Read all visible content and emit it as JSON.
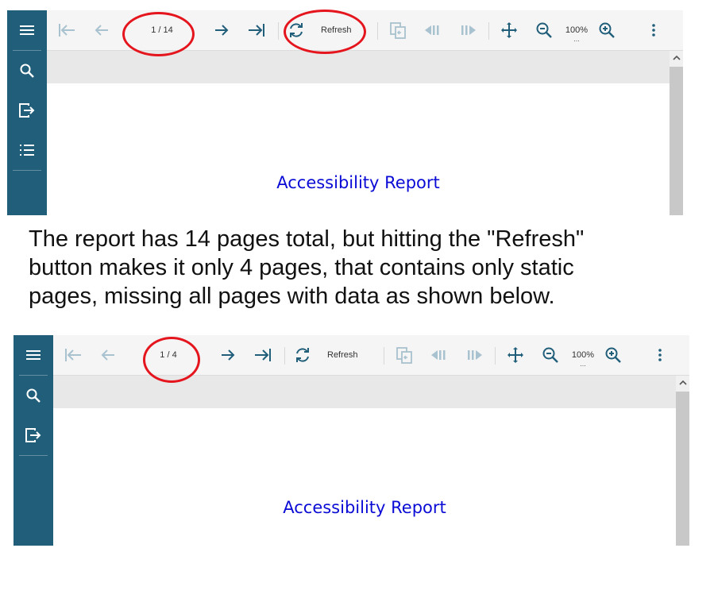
{
  "viewer_before": {
    "page_indicator": "1 / 14",
    "refresh_label": "Refresh",
    "zoom_level": "100%",
    "zoom_more": "...",
    "report_title": "Accessibility Report"
  },
  "explanation": {
    "lines": [
      "The report has 14 pages total, but hitting the \"Refresh\"",
      "button makes it only 4 pages, that contains only static",
      "pages, missing all pages with data as shown below."
    ]
  },
  "viewer_after": {
    "page_indicator": "1 / 4",
    "refresh_label": "Refresh",
    "zoom_level": "100%",
    "zoom_more": "...",
    "report_title": "Accessibility Report"
  },
  "colors": {
    "sidebar": "#205e7a",
    "toolbar_icon": "#205e7a",
    "disabled_icon": "#a9c2cf",
    "annotation_circle": "#e5151e",
    "report_title": "#0b0bd6"
  },
  "icons": {
    "menu": "hamburger-icon",
    "search": "search-icon",
    "export": "export-icon",
    "toc": "list-icon",
    "first": "first-page-icon",
    "prev": "arrow-left-icon",
    "next": "arrow-right-icon",
    "last": "last-page-icon",
    "refresh": "refresh-icon",
    "parent": "back-to-parent-icon",
    "prev_section": "previous-section-icon",
    "next_section": "next-section-icon",
    "pan": "pan-icon",
    "zoom_out": "zoom-out-icon",
    "zoom_in": "zoom-in-icon",
    "more": "more-vertical-icon"
  }
}
